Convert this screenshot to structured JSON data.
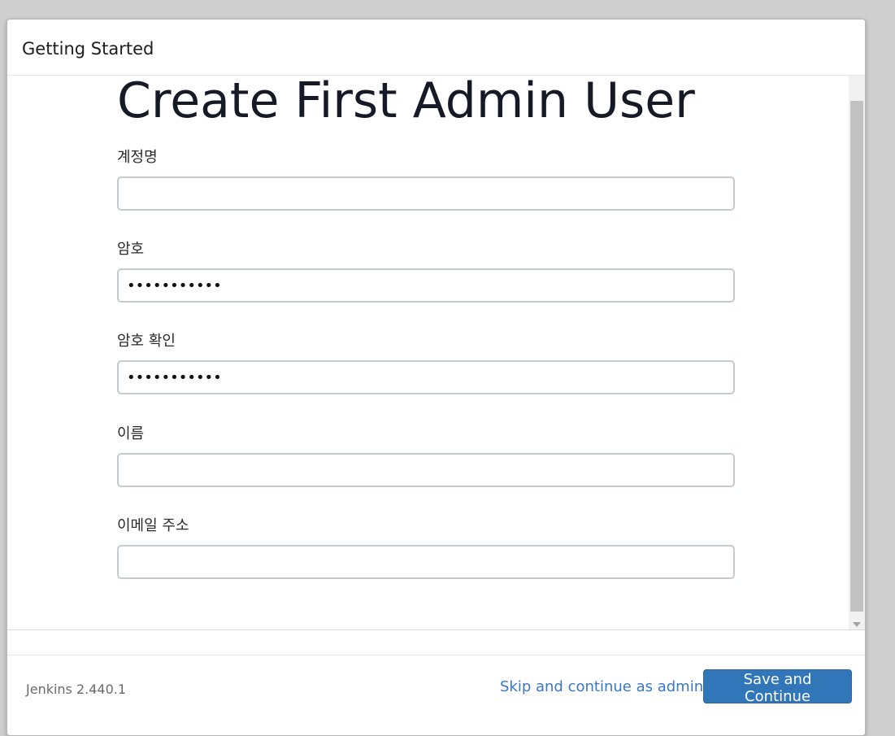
{
  "header": {
    "title": "Getting Started"
  },
  "main": {
    "heading": "Create First Admin User",
    "fields": [
      {
        "label": "계정명",
        "value": "",
        "type": "text"
      },
      {
        "label": "암호",
        "value": "•••••••••••",
        "type": "password"
      },
      {
        "label": "암호 확인",
        "value": "•••••••••••",
        "type": "password"
      },
      {
        "label": "이름",
        "value": "",
        "type": "text"
      },
      {
        "label": "이메일 주소",
        "value": "",
        "type": "text"
      }
    ]
  },
  "footer": {
    "version": "Jenkins 2.440.1",
    "skip_label": "Skip and continue as admin",
    "save_label": "Save and Continue"
  },
  "colors": {
    "primary_button": "#3276ba",
    "link": "#3a78c3",
    "input_border": "#c4cbcf"
  }
}
